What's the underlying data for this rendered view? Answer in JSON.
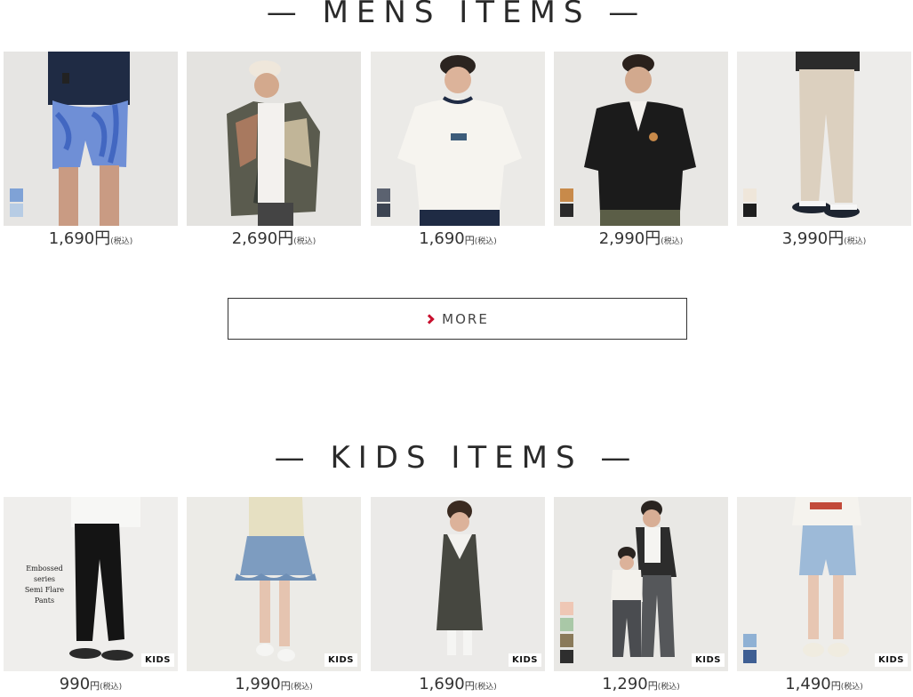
{
  "mens": {
    "title": "— MENS ITEMS —",
    "items": [
      {
        "price": "1,690",
        "yen": "円",
        "tax": "(税込)",
        "image": "man in tie-dye blue shorts",
        "swatches": [
          "#7fa2d6",
          "#b7cce4"
        ]
      },
      {
        "price": "2,690",
        "yen": "円",
        "tax": "(税込)",
        "image": "man in cap and patterned shirt",
        "swatches": []
      },
      {
        "price": "1,690",
        "yen": "円",
        "tax": "(税込)",
        "image": "man in white ringer tee",
        "swatches": [
          "#5b6270",
          "#3c4452"
        ]
      },
      {
        "price": "2,990",
        "yen": "円",
        "tax": "(税込)",
        "image": "man in black open-collar shirt",
        "swatches": [
          "#c88a4a",
          "#2a2a2a"
        ]
      },
      {
        "price": "3,990",
        "yen": "円",
        "tax": "(税込)",
        "image": "man in beige wide pants",
        "swatches": [
          "#efe6da",
          "#1e1e1e"
        ]
      }
    ],
    "more_label": "MORE"
  },
  "kids": {
    "title": "— KIDS ITEMS —",
    "items": [
      {
        "price": "990",
        "yen": "円",
        "tax": "(税込)",
        "image": "girl in black flare pants",
        "badge": "KIDS",
        "overlay": [
          "Embossed series",
          "Semi Flare Pants"
        ],
        "swatches": []
      },
      {
        "price": "1,990",
        "yen": "円",
        "tax": "(税込)",
        "image": "girl in denim ruffle skirt",
        "badge": "KIDS",
        "swatches": []
      },
      {
        "price": "1,690",
        "yen": "円",
        "tax": "(税込)",
        "image": "girl in grey jumper dress",
        "badge": "KIDS",
        "swatches": []
      },
      {
        "price": "1,290",
        "yen": "円",
        "tax": "(税込)",
        "image": "mother and child in grey pants",
        "badge": "KIDS",
        "swatches": [
          "#efc7b5",
          "#a9c8a7",
          "#8a7a5a",
          "#2e2e2e"
        ]
      },
      {
        "price": "1,490",
        "yen": "円",
        "tax": "(税込)",
        "image": "girl in light denim shorts",
        "badge": "KIDS",
        "swatches": [
          "#8fb1d4",
          "#3f5f93"
        ]
      }
    ]
  },
  "colors": {
    "accent": "#c8102e",
    "text": "#2a2a2a",
    "photo_bg": "#ebe9e6"
  }
}
